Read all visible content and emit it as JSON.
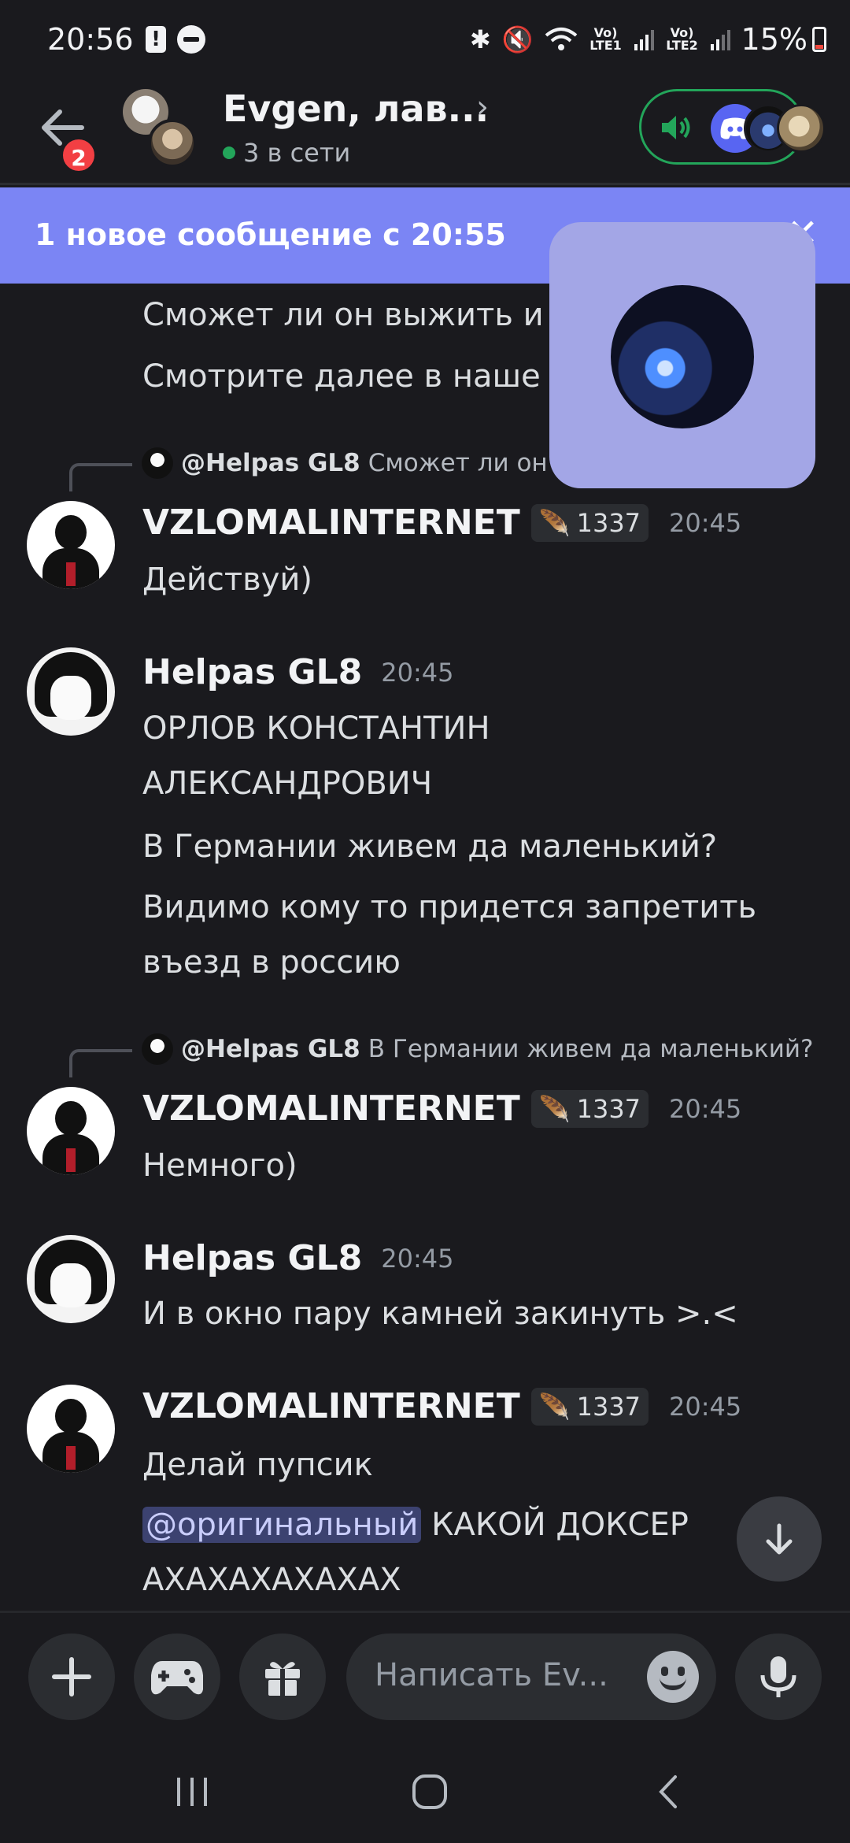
{
  "status_bar": {
    "time": "20:56",
    "lte1": "Vo) LTE1",
    "lte2": "Vo) LTE2",
    "battery": "15%"
  },
  "header": {
    "title": "Evgen, лав...",
    "online": "3 в сети",
    "unread_badge": "2"
  },
  "banner": {
    "text": "1 новое сообщение с 20:55"
  },
  "messages": {
    "partial_1": "Сможет ли он выжить и",
    "partial_2": "Смотрите далее в наше",
    "reply_1": {
      "user": "@Helpas GL8",
      "text": "Сможет ли он в"
    },
    "m1": {
      "user": "VZLOMALINTERNET",
      "badge": "1337",
      "time": "20:45",
      "text": "Действуй)"
    },
    "m2": {
      "user": "Helpas GL8",
      "time": "20:45",
      "line1": "ОРЛОВ КОНСТАНТИН",
      "line2": "АЛЕКСАНДРОВИЧ",
      "line3": "В Германии живем да маленький?",
      "line4": "Видимо кому то придется запретить",
      "line5": "въезд в россию"
    },
    "reply_2": {
      "user": "@Helpas GL8",
      "text": "В Германии живем да маленький?"
    },
    "m3": {
      "user": "VZLOMALINTERNET",
      "badge": "1337",
      "time": "20:45",
      "text": "Немного)"
    },
    "m4": {
      "user": "Helpas GL8",
      "time": "20:45",
      "text": "И в окно пару камней закинуть >.<"
    },
    "m5": {
      "user": "VZLOMALINTERNET",
      "badge": "1337",
      "time": "20:45",
      "line1": "Делай пупсик",
      "mention": "@оригинальный",
      "line2_rest": " КАКОЙ ДОКСЕР",
      "line3": "АХАХАХАХАХАХ"
    }
  },
  "composer": {
    "placeholder": "Написать Ev..."
  },
  "colors": {
    "background": "#1a1a1e",
    "banner": "#7b85f4",
    "online": "#23a55a",
    "badge": "#f23f43",
    "pip": "#a3a6e6"
  }
}
